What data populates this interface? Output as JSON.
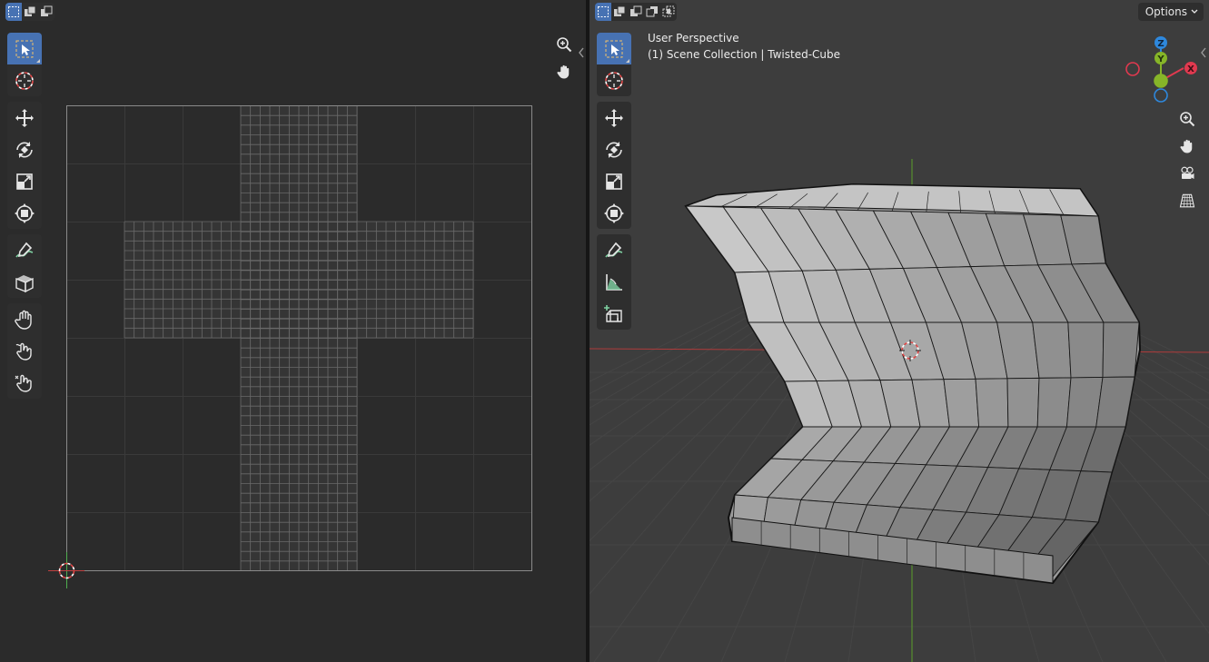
{
  "uv_editor": {
    "select_modes": [
      "select-box-icon",
      "select-extend-icon",
      "select-subtract-icon"
    ],
    "tools": [
      "select-box-icon",
      "cursor-icon",
      "move-icon",
      "rotate-icon",
      "scale-icon",
      "transform-icon",
      "annotate-icon",
      "rip-region-icon",
      "grab-icon",
      "relax-icon",
      "pinch-icon"
    ],
    "nav": [
      "zoom-icon",
      "pan-hand-icon"
    ]
  },
  "viewport": {
    "select_modes": [
      "select-box-icon",
      "select-extend-icon",
      "select-subtract-icon",
      "select-invert-icon",
      "select-intersect-icon"
    ],
    "options_label": "Options",
    "perspective_label": "User Perspective",
    "collection_label": "(1) Scene Collection | Twisted-Cube",
    "tools": [
      "select-box-icon",
      "cursor-icon",
      "move-icon",
      "rotate-icon",
      "scale-icon",
      "transform-icon",
      "annotate-icon",
      "measure-icon",
      "add-cube-icon"
    ],
    "gizmo": {
      "x_label": "X",
      "y_label": "Y",
      "z_label": "Z",
      "x_color": "#e0394f",
      "y_color": "#86b528",
      "z_color": "#2e88dd"
    },
    "nav": [
      "zoom-icon",
      "pan-hand-icon",
      "camera-view-icon",
      "ortho-grid-icon"
    ]
  }
}
